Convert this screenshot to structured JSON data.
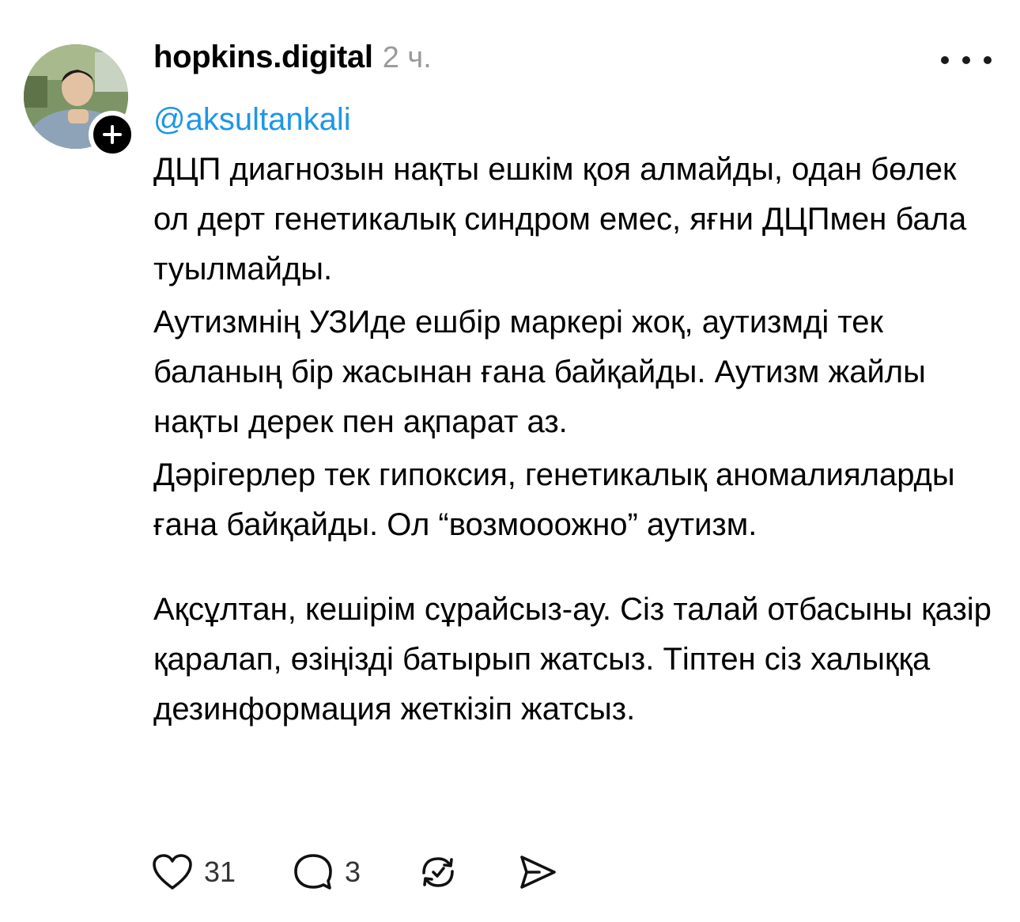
{
  "post": {
    "username": "hopkins.digital",
    "time": "2 ч.",
    "mention": "@aksultankali",
    "paragraphs": [
      "ДЦП диагнозын нақты ешкім қоя алмайды, одан бөлек ол дерт генетикалық синдром емес, яғни ДЦПмен бала туылмайды.",
      "Аутизмнің УЗИде ешбір маркері жоқ, аутизмді тек баланың бір жасынан ғана байқайды. Аутизм жайлы нақты дерек пен ақпарат аз.",
      "Дәрігерлер тек гипоксия, генетикалық аномалияларды ғана байқайды. Ол “возмооожно” аутизм.",
      "Ақсұлтан, кешірім сұрайсыз-ау. Сіз талай отбасыны қазір қаралап, өзіңізді батырып жатсыз. Тіптен сіз халыққа дезинформация жеткізіп жатсыз."
    ],
    "actions": {
      "like_icon": "heart-icon",
      "like_count": "31",
      "comment_icon": "comment-icon",
      "comment_count": "3",
      "repost_icon": "repost-icon",
      "share_icon": "share-icon"
    },
    "colors": {
      "mention": "#1d96e8",
      "time": "#9a9a9a",
      "text": "#000000"
    }
  }
}
